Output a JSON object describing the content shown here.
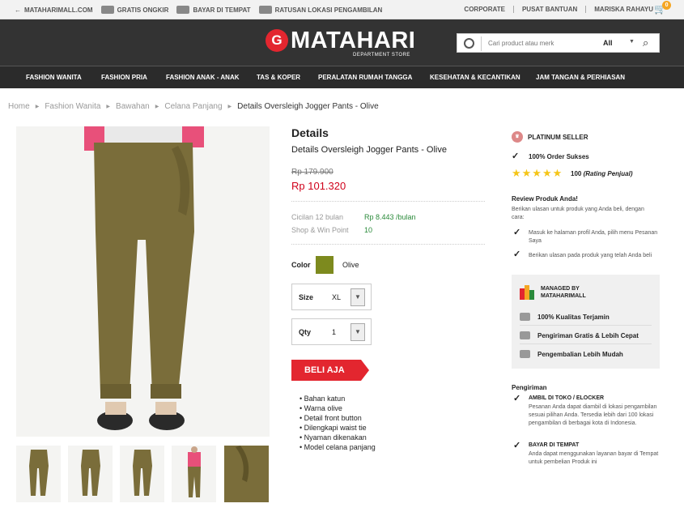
{
  "topbar": {
    "links": [
      "MATAHARIMALL.COM",
      "GRATIS ONGKIR",
      "BAYAR DI TEMPAT",
      "RATUSAN LOKASI PENGAMBILAN"
    ],
    "right_links": [
      "CORPORATE",
      "PUSAT BANTUAN",
      "MARISKA RAHAYU"
    ],
    "cart_count": "0"
  },
  "header": {
    "logo_text": "MATAHARI",
    "logo_sub": "DEPARTMENT STORE",
    "search_placeholder": "Cari product atau merk",
    "search_category": "All"
  },
  "nav": [
    "FASHION WANITA",
    "FASHION PRIA",
    "FASHION ANAK - ANAK",
    "TAS & KOPER",
    "PERALATAN RUMAH TANGGA",
    "KESEHATAN & KECANTIKAN",
    "JAM TANGAN & PERHIASAN"
  ],
  "breadcrumb": [
    "Home",
    "Fashion Wanita",
    "Bawahan",
    "Celana Panjang",
    "Details Oversleigh Jogger Pants - Olive"
  ],
  "product": {
    "brand": "Details",
    "name": "Details Oversleigh Jogger Pants - Olive",
    "old_price": "Rp 179.900",
    "new_price": "Rp 101.320",
    "installment_label": "Cicilan 12 bulan",
    "installment_value": "Rp 8.443 /bulan",
    "points_label": "Shop & Win Point",
    "points_value": "10",
    "color_label": "Color",
    "color_value": "Olive",
    "color_hex": "#7d8a1e",
    "size_label": "Size",
    "size_value": "XL",
    "qty_label": "Qty",
    "qty_value": "1",
    "buy_label": "BELI AJA",
    "features": [
      "Bahan katun",
      "Warna olive",
      "Detail front button",
      "Dilengkapi waist tie",
      "Nyaman dikenakan",
      "Model celana panjang"
    ]
  },
  "seller": {
    "badge": "PLATINUM SELLER",
    "order_success": "100% Order Sukses",
    "rating_value": "100",
    "rating_label": "(Rating Penjual)",
    "review_title": "Review Produk Anda!",
    "review_text": "Berikan ulasan untuk produk yang Anda beli, dengan cara:",
    "review_step1": "Masuk ke halaman profil Anda, pilih menu Pesanan Saya",
    "review_step2": "Berikan ulasan pada produk yang telah Anda beli",
    "managed_title": "MANAGED BY MATAHARIMALL",
    "managed_items": [
      "100% Kualitas Terjamin",
      "Pengiriman Gratis & Lebih Cepat",
      "Pengembalian Lebih Mudah"
    ],
    "shipping_title": "Pengiriman",
    "ship1_title": "AMBIL DI TOKO / ELOCKER",
    "ship1_text": "Pesanan Anda dapat diambil di lokasi pengambilan sesuai pilihan Anda. Tersedia lebih dari 100 lokasi pengambilan di berbagai kota di Indonesia.",
    "ship2_title": "BAYAR DI TEMPAT",
    "ship2_text": "Anda dapat menggunakan layanan bayar di Tempat untuk pembelian Produk ini"
  }
}
